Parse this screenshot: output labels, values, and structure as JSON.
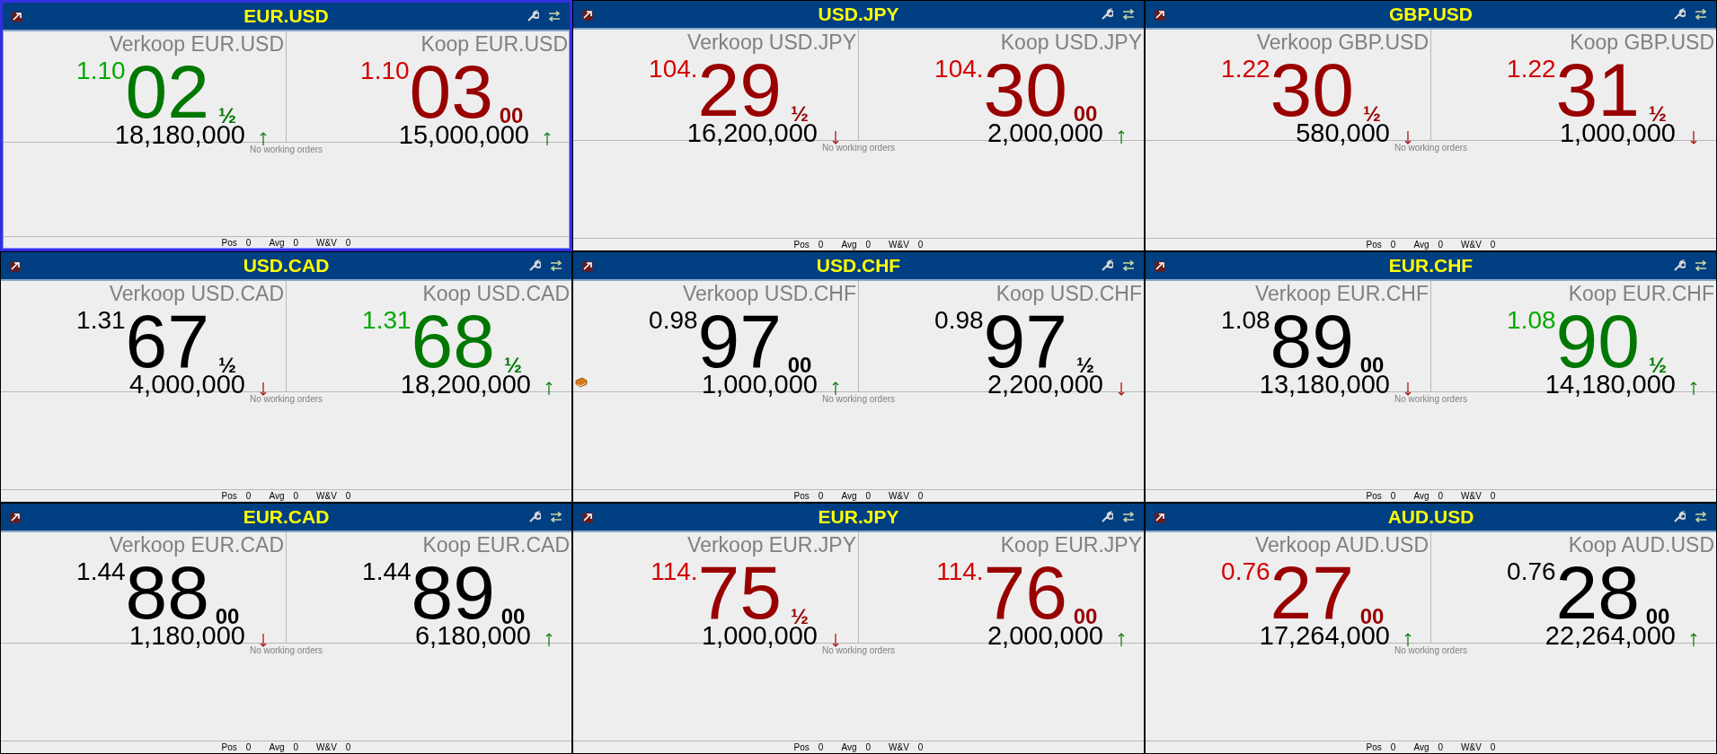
{
  "panels": [
    {
      "title": "EUR.USD",
      "selected": true,
      "quotes": [
        {
          "label": "Verkoop EUR.USD",
          "prefix": "1.10",
          "big": "02",
          "frac": "½",
          "size": "18,180,000",
          "color": "#007700",
          "rising": true
        },
        {
          "label": "Koop EUR.USD",
          "prefix": "1.10",
          "big": "03",
          "frac": "00",
          "size": "15,000,000",
          "color": "#990000",
          "rising": true
        }
      ],
      "orders": "No working orders",
      "footer": [
        {
          "label": "Pos",
          "value": "0"
        },
        {
          "label": "Avg",
          "value": "0"
        },
        {
          "label": "W&V",
          "value": "0"
        }
      ]
    },
    {
      "title": "USD.JPY",
      "selected": false,
      "quotes": [
        {
          "label": "Verkoop USD.JPY",
          "prefix": "104.",
          "big": "29",
          "frac": "½",
          "size": "16,200,000",
          "color": "#990000",
          "rising": false
        },
        {
          "label": "Koop USD.JPY",
          "prefix": "104.",
          "big": "30",
          "frac": "00",
          "size": "2,000,000",
          "color": "#990000",
          "rising": true
        }
      ],
      "orders": "No working orders",
      "footer": [
        {
          "label": "Pos",
          "value": "0"
        },
        {
          "label": "Avg",
          "value": "0"
        },
        {
          "label": "W&V",
          "value": "0"
        }
      ]
    },
    {
      "title": "GBP.USD",
      "selected": false,
      "quotes": [
        {
          "label": "Verkoop GBP.USD",
          "prefix": "1.22",
          "big": "30",
          "frac": "½",
          "size": "580,000",
          "color": "#990000",
          "rising": false
        },
        {
          "label": "Koop GBP.USD",
          "prefix": "1.22",
          "big": "31",
          "frac": "½",
          "size": "1,000,000",
          "color": "#990000",
          "rising": false
        }
      ],
      "orders": "No working orders",
      "footer": [
        {
          "label": "Pos",
          "value": "0"
        },
        {
          "label": "Avg",
          "value": "0"
        },
        {
          "label": "W&V",
          "value": "0"
        }
      ]
    },
    {
      "title": "USD.CAD",
      "selected": false,
      "quotes": [
        {
          "label": "Verkoop USD.CAD",
          "prefix": "1.31",
          "big": "67",
          "frac": "½",
          "size": "4,000,000",
          "color": "#000000",
          "rising": false
        },
        {
          "label": "Koop USD.CAD",
          "prefix": "1.31",
          "big": "68",
          "frac": "½",
          "size": "18,200,000",
          "color": "#007700",
          "rising": true
        }
      ],
      "orders": "No working orders",
      "footer": [
        {
          "label": "Pos",
          "value": "0"
        },
        {
          "label": "Avg",
          "value": "0"
        },
        {
          "label": "W&V",
          "value": "0"
        }
      ]
    },
    {
      "title": "USD.CHF",
      "selected": false,
      "quotes": [
        {
          "label": "Verkoop USD.CHF",
          "prefix": "0.98",
          "big": "97",
          "frac": "00",
          "size": "1,000,000",
          "color": "#000000",
          "rising": true,
          "book": true
        },
        {
          "label": "Koop USD.CHF",
          "prefix": "0.98",
          "big": "97",
          "frac": "½",
          "size": "2,200,000",
          "color": "#000000",
          "rising": false
        }
      ],
      "orders": "No working orders",
      "footer": [
        {
          "label": "Pos",
          "value": "0"
        },
        {
          "label": "Avg",
          "value": "0"
        },
        {
          "label": "W&V",
          "value": "0"
        }
      ]
    },
    {
      "title": "EUR.CHF",
      "selected": false,
      "quotes": [
        {
          "label": "Verkoop EUR.CHF",
          "prefix": "1.08",
          "big": "89",
          "frac": "00",
          "size": "13,180,000",
          "color": "#000000",
          "rising": false
        },
        {
          "label": "Koop EUR.CHF",
          "prefix": "1.08",
          "big": "90",
          "frac": "½",
          "size": "14,180,000",
          "color": "#007700",
          "rising": true
        }
      ],
      "orders": "No working orders",
      "footer": [
        {
          "label": "Pos",
          "value": "0"
        },
        {
          "label": "Avg",
          "value": "0"
        },
        {
          "label": "W&V",
          "value": "0"
        }
      ]
    },
    {
      "title": "EUR.CAD",
      "selected": false,
      "quotes": [
        {
          "label": "Verkoop EUR.CAD",
          "prefix": "1.44",
          "big": "88",
          "frac": "00",
          "size": "1,180,000",
          "color": "#000000",
          "rising": false
        },
        {
          "label": "Koop EUR.CAD",
          "prefix": "1.44",
          "big": "89",
          "frac": "00",
          "size": "6,180,000",
          "color": "#000000",
          "rising": true
        }
      ],
      "orders": "No working orders",
      "footer": [
        {
          "label": "Pos",
          "value": "0"
        },
        {
          "label": "Avg",
          "value": "0"
        },
        {
          "label": "W&V",
          "value": "0"
        }
      ]
    },
    {
      "title": "EUR.JPY",
      "selected": false,
      "quotes": [
        {
          "label": "Verkoop EUR.JPY",
          "prefix": "114.",
          "big": "75",
          "frac": "½",
          "size": "1,000,000",
          "color": "#990000",
          "rising": false
        },
        {
          "label": "Koop EUR.JPY",
          "prefix": "114.",
          "big": "76",
          "frac": "00",
          "size": "2,000,000",
          "color": "#990000",
          "rising": true
        }
      ],
      "orders": "No working orders",
      "footer": [
        {
          "label": "Pos",
          "value": "0"
        },
        {
          "label": "Avg",
          "value": "0"
        },
        {
          "label": "W&V",
          "value": "0"
        }
      ]
    },
    {
      "title": "AUD.USD",
      "selected": false,
      "quotes": [
        {
          "label": "Verkoop AUD.USD",
          "prefix": "0.76",
          "big": "27",
          "frac": "00",
          "size": "17,264,000",
          "color": "#990000",
          "rising": true
        },
        {
          "label": "Koop AUD.USD",
          "prefix": "0.76",
          "big": "28",
          "frac": "00",
          "size": "22,264,000",
          "color": "#000000",
          "rising": true
        }
      ],
      "orders": "No working orders",
      "footer": [
        {
          "label": "Pos",
          "value": "0"
        },
        {
          "label": "Avg",
          "value": "0"
        },
        {
          "label": "W&V",
          "value": "0"
        }
      ]
    }
  ]
}
